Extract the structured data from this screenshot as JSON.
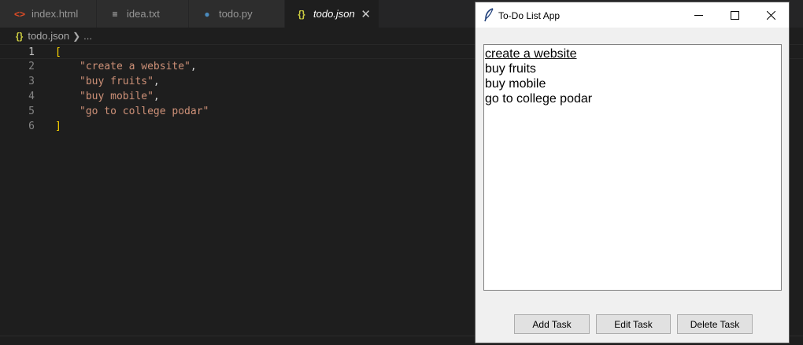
{
  "editor": {
    "tabs": [
      {
        "label": "index.html",
        "icon": "html-icon",
        "glyph": "<>",
        "color": "#e44d26"
      },
      {
        "label": "idea.txt",
        "icon": "text-file-icon",
        "glyph": "≡",
        "color": "#c5c5c5"
      },
      {
        "label": "todo.py",
        "icon": "python-icon",
        "glyph": "●",
        "color": "#4b8bbe"
      },
      {
        "label": "todo.json",
        "icon": "json-icon",
        "glyph": "{}",
        "color": "#cbcb41",
        "active": true
      }
    ],
    "close_glyph": "✕",
    "breadcrumb": {
      "file": "todo.json",
      "rest": "..."
    },
    "lines": [
      {
        "number": "1",
        "open": "[",
        "current": true
      },
      {
        "number": "2",
        "value": "\"create a website\"",
        "punc": ","
      },
      {
        "number": "3",
        "value": "\"buy fruits\"",
        "punc": ","
      },
      {
        "number": "4",
        "value": "\"buy mobile\"",
        "punc": ","
      },
      {
        "number": "5",
        "value": "\"go to college podar\"",
        "punc": ""
      },
      {
        "number": "6",
        "close": "]"
      }
    ]
  },
  "app": {
    "title": "To-Do List App",
    "tasks": [
      "create a website",
      "buy fruits",
      "buy mobile",
      "go to college podar"
    ],
    "buttons": {
      "add": "Add Task",
      "edit": "Edit Task",
      "delete": "Delete Task"
    }
  },
  "colors": {
    "editor_bg": "#1e1e1e",
    "string": "#ce9178",
    "bracket": "#ffd700",
    "window_bg": "#f0f0f0"
  }
}
